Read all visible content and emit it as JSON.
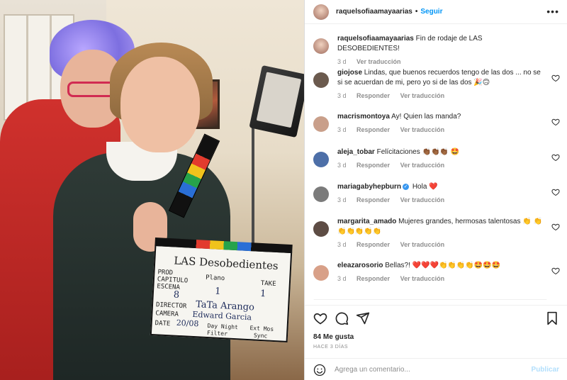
{
  "header": {
    "username": "raquelsofiaamayaarias",
    "separator": "•",
    "follow_label": "Seguir",
    "more_label": "•••"
  },
  "photo": {
    "slate_title": "LAS Desobedientes",
    "slate_rows": {
      "prod": "PROD",
      "capitulo": "CAPITULO",
      "escena": "ESCENA",
      "plano": "Plano",
      "take": "TAKE",
      "escena_val": "8",
      "plano_val": "1",
      "take_val": "1",
      "director_label": "DIRECTOR",
      "director": "TaTa Arango",
      "camera_label": "CAMERA",
      "camera": "Edward Garcia",
      "date_label": "DATE",
      "date": "20/08",
      "daynight": "Day Night",
      "ext": "Ext Mos",
      "filter": "Filter",
      "sync": "Sync"
    }
  },
  "caption": {
    "username": "raquelsofiaamayaarias",
    "text": "Fin de rodaje de LAS DESOBEDIENTES!",
    "time": "3 d",
    "translate": "Ver traducción"
  },
  "comments": [
    {
      "username": "giojose",
      "text": "Lindas, que buenos recuerdos tengo de las dos ... no se si se acuerdan de mi, pero yo si de las dos 🎉🙃",
      "time": "3 d",
      "reply": "Responder",
      "translate": "Ver traducción",
      "avatar": "#6b5a4e"
    },
    {
      "username": "macrismontoya",
      "text": "Ay! Quien las manda?",
      "time": "3 d",
      "reply": "Responder",
      "translate": "Ver traducción",
      "avatar": "#c99f8a"
    },
    {
      "username": "aleja_tobar",
      "text": "Felícitaciones 👏🏾👏🏾👏🏾 🤩",
      "time": "3 d",
      "reply": "Responder",
      "translate": "Ver traducción",
      "avatar": "#4d6fa8"
    },
    {
      "username": "mariagabyhepburn",
      "verified": "✓",
      "text": "Hola ❤️",
      "time": "3 d",
      "reply": "Responder",
      "translate": "Ver traducción",
      "avatar": "#7b7b7b"
    },
    {
      "username": "margarita_amado",
      "text": "Mujeres grandes, hermosas talentosas 👏 👏👏👏👏👏👏",
      "time": "3 d",
      "reply": "Responder",
      "translate": "Ver traducción",
      "avatar": "#5d4c44"
    },
    {
      "username": "eleazarosorio",
      "text": "Bellas?! ❤️❤️❤️👏👏👏👏🤩🤩🤩",
      "time": "3 d",
      "reply": "Responder",
      "translate": "Ver traducción",
      "avatar": "#d8a088"
    }
  ],
  "stats": {
    "likes": "84 Me gusta",
    "date": "HACE 3 DÍAS"
  },
  "add_comment": {
    "placeholder": "Agrega un comentario...",
    "publish": "Publicar"
  },
  "icons": {
    "heart": "heart-icon",
    "comment": "comment-icon",
    "share": "share-icon",
    "save": "bookmark-icon",
    "emoji": "emoji-icon"
  },
  "colors": {
    "accent": "#0095f6",
    "muted": "#8e8e8e",
    "publish_disabled": "#b2dffc"
  }
}
